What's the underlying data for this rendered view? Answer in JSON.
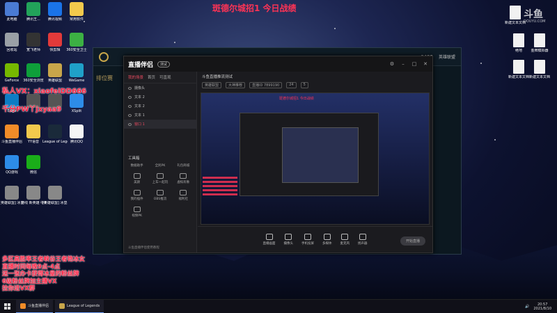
{
  "overlay": {
    "title": "斑德尔城招1 今日战绩",
    "watermark": "斗鱼",
    "watermark_sub": "DOUYU.COM"
  },
  "notes": {
    "vx": "私人VX：xiaofeiDD666",
    "pw": "千分PW丫jxyaa9",
    "block": [
      "多区高胜率王者峡谷王者艳冰女",
      "直播时间每晚9点-4点",
      "送一张办卡获得冰皇的粉丝牌",
      "6级粉丝牌加主播VX",
      "拉你进VX群"
    ]
  },
  "desktop_left": [
    {
      "label": "此电脑",
      "color": "#4a7bd4"
    },
    {
      "label": "腾讯王...",
      "color": "#22a35a"
    },
    {
      "label": "腾讯视频",
      "color": "#1a73e8"
    },
    {
      "label": "常用软件",
      "color": "#f2c94c"
    },
    {
      "label": "回收站",
      "color": "#9aa0a6"
    },
    {
      "label": "宽飞老师",
      "color": "#333"
    },
    {
      "label": "快剪辑",
      "color": "#e23a3a"
    },
    {
      "label": "360安全卫士",
      "color": "#3cb043"
    },
    {
      "label": "GeForce",
      "color": "#76b900"
    },
    {
      "label": "360安全浏览",
      "color": "#0e9f3a"
    },
    {
      "label": "英雄联盟",
      "color": "#c8a64a"
    },
    {
      "label": "WeGame",
      "color": "#1fa0c8"
    },
    {
      "label": "Edge",
      "color": "#0d7cc4"
    },
    {
      "label": "",
      "color": "#555"
    },
    {
      "label": "",
      "color": "#555"
    },
    {
      "label": "XSplit",
      "color": "#2d8ce8"
    },
    {
      "label": "斗鱼直播伴侣",
      "color": "#f28c28"
    },
    {
      "label": "YY语音",
      "color": "#f2c94c"
    },
    {
      "label": "League of Legends",
      "color": "#1a2a3a"
    },
    {
      "label": "腾讯QQ",
      "color": "#f5f5f5"
    },
    {
      "label": "QQ游戏",
      "color": "#2d8ce8"
    },
    {
      "label": "微信",
      "color": "#1aad19"
    },
    {
      "label": "",
      "color": "transparent"
    },
    {
      "label": "",
      "color": "transparent"
    },
    {
      "label": "[英雄联盟] 冰皇小飞...",
      "color": "#888"
    },
    {
      "label": "对线 新英雄 中单...",
      "color": "#888"
    },
    {
      "label": "[英雄联盟] 冰皇小飞...",
      "color": "#888"
    }
  ],
  "desktop_right": [
    {
      "label": "新建文本文档",
      "color": "#f1f1f1"
    },
    {
      "label": "绝地",
      "color": "#f1f1f1"
    },
    {
      "label": "金牌模拟器",
      "color": "#f1f1f1"
    },
    {
      "label": "新建文本文档",
      "color": "#f1f1f1"
    },
    {
      "label": "新建文本文档",
      "color": "#f1f1f1"
    }
  ],
  "lol": {
    "side_text": "排位赛",
    "coins": "6422",
    "brand": "英雄联盟"
  },
  "obs": {
    "brand": "直播伴侣",
    "badge": "测试",
    "tabs": [
      "我的场景",
      "首页",
      "可直观"
    ],
    "scenes": [
      "摄像头",
      "文本 2",
      "文本 2",
      "文本 1",
      "窗口 1"
    ],
    "tools_title": "工具箱",
    "tool_sub": [
      "数据助手",
      "全民PK",
      "礼包商城"
    ],
    "tools": [
      "美颜",
      "上车一起玩",
      "虚拟形象",
      "我的插件",
      "OBS推流",
      "福利社",
      "视频PK"
    ],
    "left_bottom": "斗鱼直播伴侣使用教程",
    "stream_title": "斗鱼直播推流测试",
    "info_tags": [
      "英雄联盟",
      "大神推荐",
      "直播ID 7899190",
      "24",
      "5"
    ],
    "preview_caption": "斑德尔城招1 今日战绩",
    "bottom_buttons": [
      "直播画面",
      "摄像头",
      "手机投屏",
      "多媒体",
      "麦克风",
      "扬声器"
    ],
    "start_label": "开始直播"
  },
  "taskbar": {
    "items": [
      {
        "label": "斗鱼直播伴侣",
        "color": "#f28c28"
      },
      {
        "label": "League of Legends",
        "color": "#c8a64a"
      }
    ],
    "time": "20:57",
    "date": "2021/8/10"
  }
}
